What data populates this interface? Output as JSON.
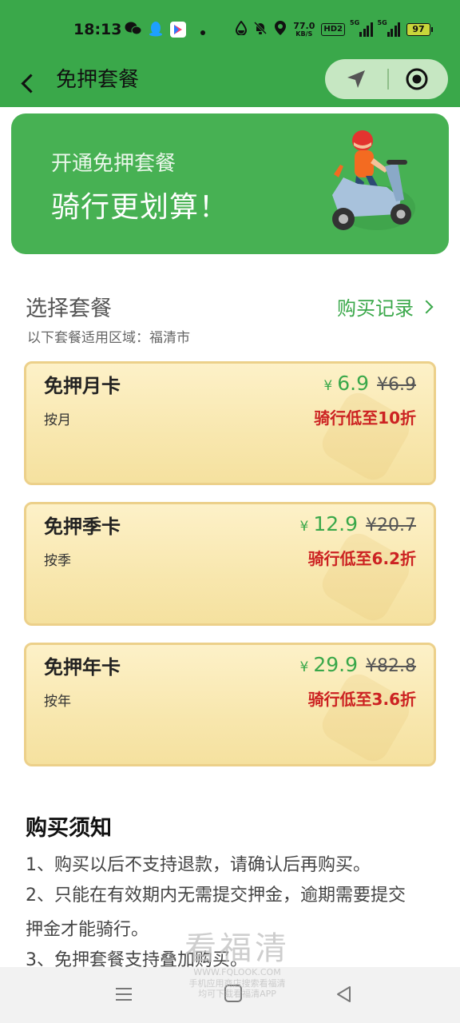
{
  "status_bar": {
    "time": "18:13",
    "net_speed_value": "77.0",
    "net_speed_unit": "KB/S",
    "hd_tag": "HD2",
    "sim1_label": "5G",
    "sim2_label": "5G",
    "battery_level": "97",
    "icons": [
      "wechat-icon",
      "qq-icon",
      "app-icon",
      "dot-icon",
      "water-drop-icon",
      "mute-icon",
      "location-icon"
    ]
  },
  "header": {
    "title": "免押套餐"
  },
  "banner": {
    "subtitle": "开通免押套餐",
    "title": "骑行更划算！"
  },
  "packages_section": {
    "title": "选择套餐",
    "records_link": "购买记录",
    "region_note": "以下套餐适用区域：福清市",
    "currency": "¥",
    "packages": [
      {
        "name": "免押月卡",
        "period": "按月",
        "price": "6.9",
        "original_price": "¥6.9",
        "discount": "骑行低至10折"
      },
      {
        "name": "免押季卡",
        "period": "按季",
        "price": "12.9",
        "original_price": "¥20.7",
        "discount": "骑行低至6.2折"
      },
      {
        "name": "免押年卡",
        "period": "按年",
        "price": "29.9",
        "original_price": "¥82.8",
        "discount": "骑行低至3.6折"
      }
    ]
  },
  "notice": {
    "title": "购买须知",
    "lines": [
      "1、购买以后不支持退款，请确认后再购买。",
      "2、只能在有效期内无需提交押金，逾期需要提交",
      "押金才能骑行。",
      "3、免押套餐支持叠加购买。"
    ]
  },
  "watermark": {
    "big": "看福清",
    "url": "WWW.FQLOOK.COM",
    "line1": "手机应用商店搜索看福清",
    "line2": "均可下载看福清APP"
  },
  "colors": {
    "brand_green": "#3aa84a",
    "banner_green": "#47b153",
    "discount_red": "#cc2222",
    "card_bg": "#fbecbd",
    "card_border": "#ecd08a"
  }
}
